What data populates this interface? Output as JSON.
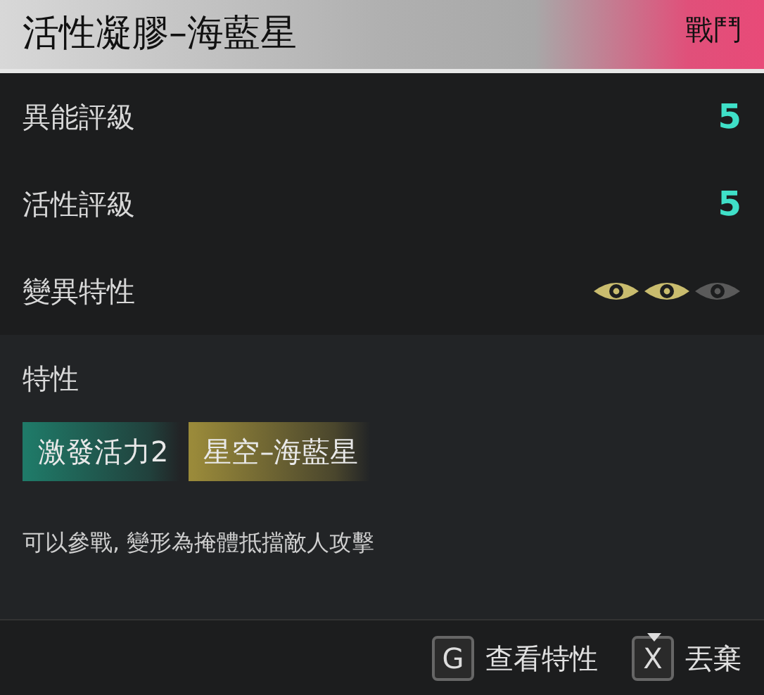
{
  "header": {
    "title": "活性凝膠–海藍星",
    "badge": "戰鬥"
  },
  "stats": [
    {
      "kind": "value",
      "label": "異能評級",
      "value": "5"
    },
    {
      "kind": "value",
      "label": "活性評級",
      "value": "5"
    },
    {
      "kind": "eyes",
      "label": "變異特性",
      "eyes": [
        {
          "on": true
        },
        {
          "on": true
        },
        {
          "on": false
        }
      ]
    }
  ],
  "traits": {
    "heading": "特性",
    "tags": [
      {
        "label": "激發活力2",
        "color": "#1f7a68"
      },
      {
        "label": "星空–海藍星",
        "color": "#9a8a3a"
      }
    ],
    "description": "可以參戰, 變形為掩體抵擋敵人攻擊"
  },
  "footer": [
    {
      "key": "G",
      "label": "查看特性",
      "selected": false
    },
    {
      "key": "X",
      "label": "丟棄",
      "selected": true
    }
  ]
}
